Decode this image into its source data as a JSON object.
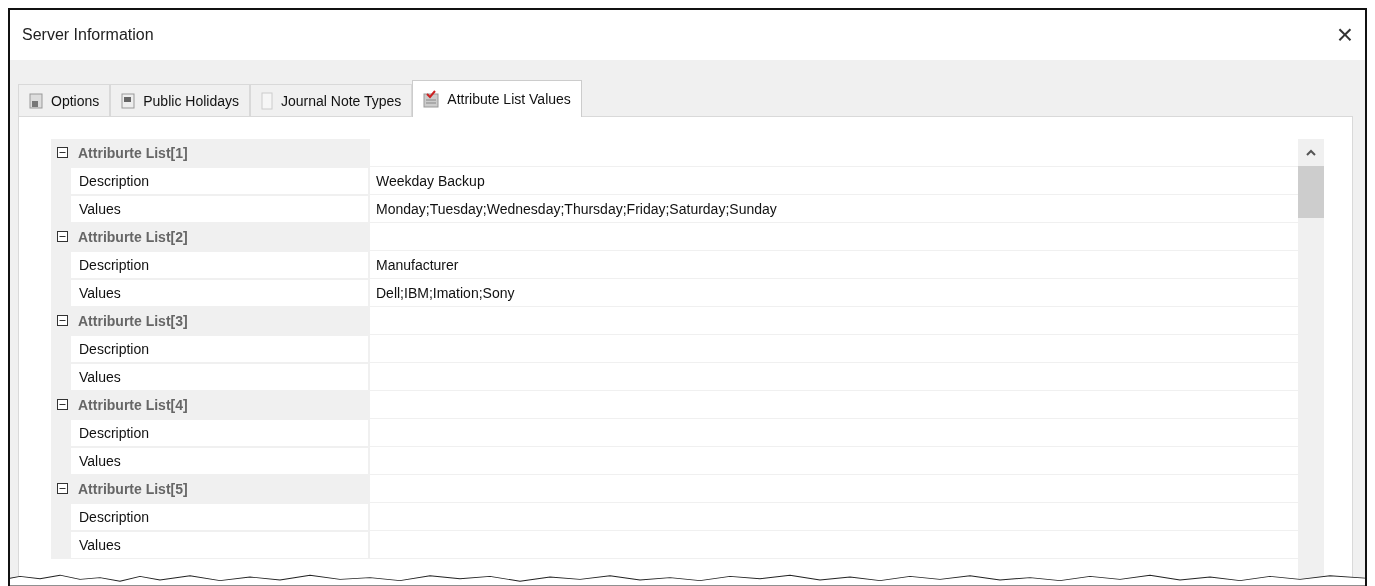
{
  "window": {
    "title": "Server Information",
    "close": "×"
  },
  "tabs": [
    {
      "label": "Options",
      "selected": false
    },
    {
      "label": "Public Holidays",
      "selected": false
    },
    {
      "label": "Journal Note Types",
      "selected": false
    },
    {
      "label": "Attribute List Values",
      "selected": true
    }
  ],
  "grid": {
    "categories": [
      {
        "title": "Attriburte List[1]",
        "expanded": true,
        "properties": [
          {
            "name": "Description",
            "value": "Weekday Backup"
          },
          {
            "name": "Values",
            "value": "Monday;Tuesday;Wednesday;Thursday;Friday;Saturday;Sunday"
          }
        ]
      },
      {
        "title": "Attriburte List[2]",
        "expanded": true,
        "properties": [
          {
            "name": "Description",
            "value": "Manufacturer"
          },
          {
            "name": "Values",
            "value": "Dell;IBM;Imation;Sony"
          }
        ]
      },
      {
        "title": "Attriburte List[3]",
        "expanded": true,
        "properties": [
          {
            "name": "Description"
          },
          {
            "name": "Values"
          }
        ]
      },
      {
        "title": "Attriburte List[4]",
        "expanded": true,
        "properties": [
          {
            "name": "Description"
          },
          {
            "name": "Values"
          }
        ]
      },
      {
        "title": "Attriburte List[5]",
        "expanded": true,
        "properties": [
          {
            "name": "Description"
          },
          {
            "name": "Values"
          }
        ]
      }
    ]
  }
}
